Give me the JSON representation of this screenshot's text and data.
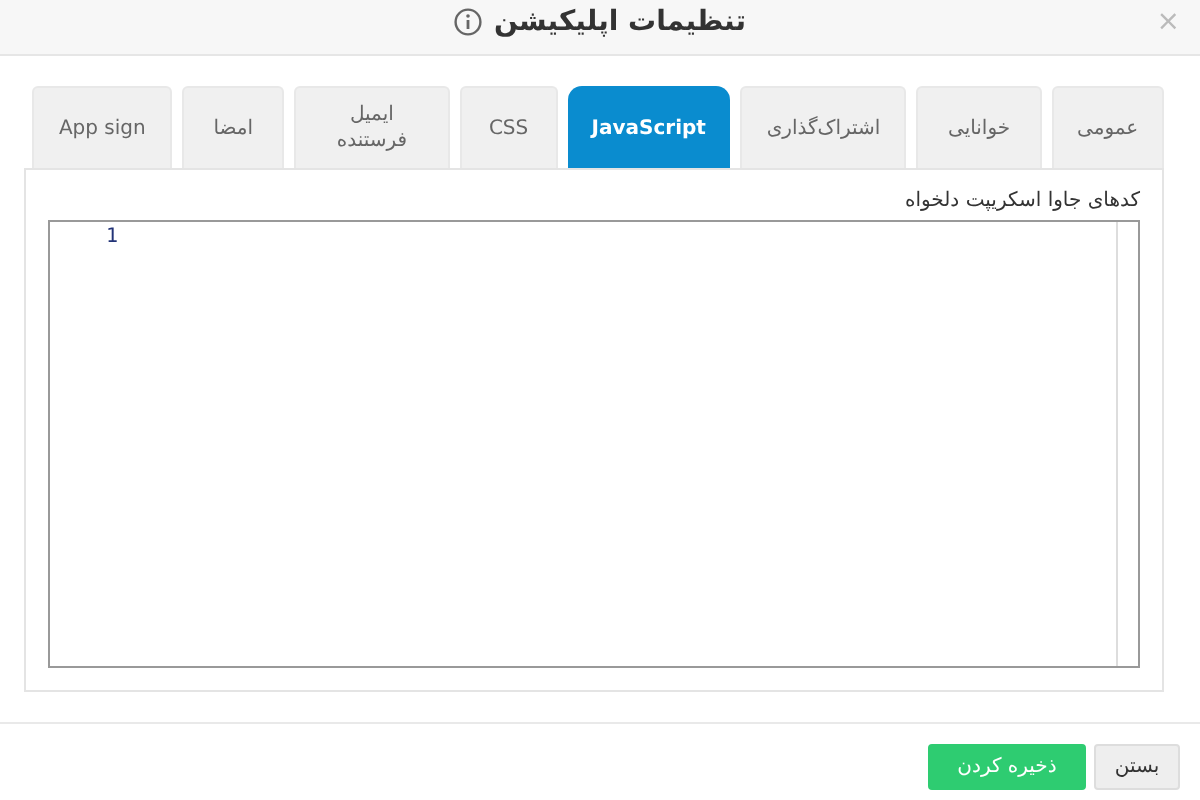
{
  "dialog": {
    "title": "تنظیمات اپلیکیشن",
    "close": "×"
  },
  "tabs": [
    {
      "label": "عمومی",
      "selected": false
    },
    {
      "label": "خوانایی",
      "selected": false
    },
    {
      "label": "اشتراک‌گذاری",
      "selected": false
    },
    {
      "label": "JavaScript",
      "selected": true
    },
    {
      "label": "CSS",
      "selected": false
    },
    {
      "label": "ایمیل فرستنده",
      "selected": false
    },
    {
      "label": "امضا",
      "selected": false
    },
    {
      "label": "App sign",
      "selected": false
    }
  ],
  "editor": {
    "label": "کدهای جاوا اسکریپت دلخواه",
    "line_numbers": [
      "1"
    ]
  },
  "buttons": [
    {
      "label": "بستن",
      "kind": "secondary"
    },
    {
      "label": "ذخیره کردن",
      "kind": "primary"
    }
  ]
}
